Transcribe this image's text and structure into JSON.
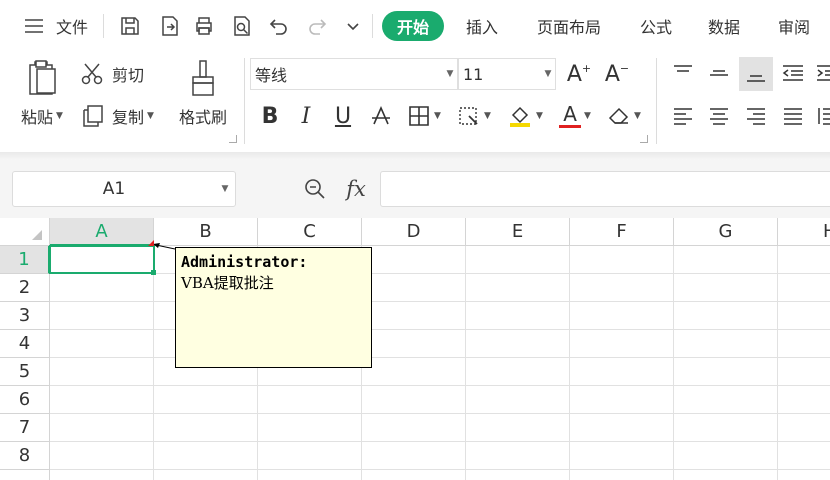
{
  "menubar": {
    "file_label": "文件",
    "tabs": [
      "开始",
      "插入",
      "页面布局",
      "公式",
      "数据",
      "审阅"
    ],
    "icons": [
      "hamburger-icon",
      "save-icon",
      "export-icon",
      "print-icon",
      "print-preview-icon",
      "undo-icon",
      "redo-icon",
      "more-dropdown-icon"
    ]
  },
  "ribbon": {
    "paste_label": "粘贴",
    "cut_label": "剪切",
    "copy_label": "复制",
    "format_painter_label": "格式刷",
    "font_name": "等线",
    "font_size": "11",
    "bold": "B",
    "italic": "I",
    "underline": "U",
    "grow_font": "A",
    "shrink_font": "A",
    "font_color_letter": "A",
    "font_color": "#e02020",
    "fill_color": "#f5d800"
  },
  "formula_bar": {
    "name_box": "A1",
    "fx_label": "fx",
    "formula": ""
  },
  "grid": {
    "columns": [
      "A",
      "B",
      "C",
      "D",
      "E",
      "F",
      "G",
      "H"
    ],
    "rows": [
      "1",
      "2",
      "3",
      "4",
      "5",
      "6",
      "7",
      "8"
    ],
    "selected_cell": "A1",
    "accent": "#1aab6e"
  },
  "comment": {
    "author": "Administrator:",
    "text": "VBA提取批注"
  }
}
